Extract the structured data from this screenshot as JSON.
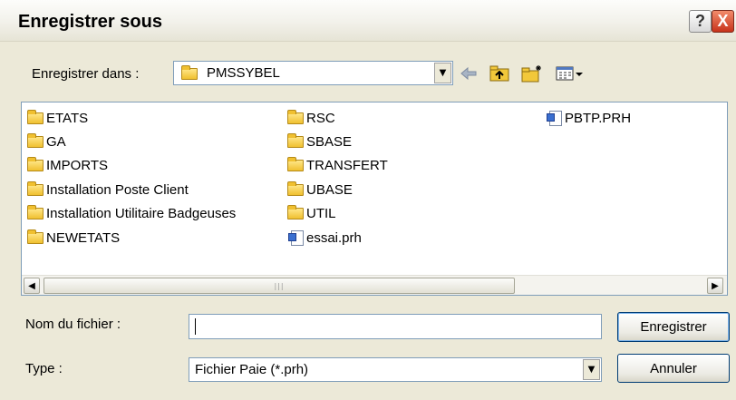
{
  "window": {
    "title": "Enregistrer sous",
    "help_symbol": "?",
    "close_symbol": "X"
  },
  "save_in": {
    "label": "Enregistrer dans :",
    "value": "PMSSYBEL"
  },
  "toolbar": {
    "icons": [
      "back-arrow-icon",
      "up-folder-icon",
      "new-folder-icon",
      "view-menu-icon"
    ]
  },
  "files": {
    "col1": [
      {
        "name": "ETATS",
        "kind": "folder"
      },
      {
        "name": "GA",
        "kind": "folder"
      },
      {
        "name": "IMPORTS",
        "kind": "folder"
      },
      {
        "name": "Installation Poste Client",
        "kind": "folder"
      },
      {
        "name": "Installation Utilitaire Badgeuses",
        "kind": "folder"
      },
      {
        "name": "NEWETATS",
        "kind": "folder"
      }
    ],
    "col2": [
      {
        "name": "RSC",
        "kind": "folder"
      },
      {
        "name": "SBASE",
        "kind": "folder"
      },
      {
        "name": "TRANSFERT",
        "kind": "folder"
      },
      {
        "name": "UBASE",
        "kind": "folder"
      },
      {
        "name": "UTIL",
        "kind": "folder"
      },
      {
        "name": "essai.prh",
        "kind": "file"
      }
    ],
    "col3": [
      {
        "name": "PBTP.PRH",
        "kind": "file"
      }
    ]
  },
  "filename": {
    "label": "Nom du fichier :",
    "value": ""
  },
  "filetype": {
    "label": "Type :",
    "value": "Fichier Paie (*.prh)"
  },
  "buttons": {
    "save": "Enregistrer",
    "cancel": "Annuler"
  }
}
